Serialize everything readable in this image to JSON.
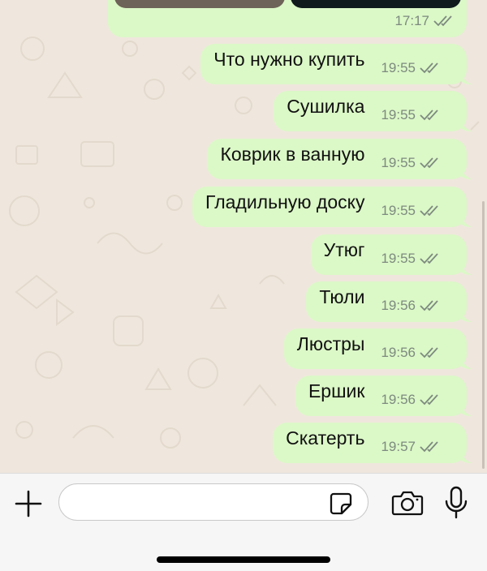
{
  "previous_message": {
    "time": "17:17",
    "status_icon": "double-check-icon"
  },
  "messages": [
    {
      "text": "Что нужно купить",
      "time": "19:55",
      "status_icon": "double-check-icon"
    },
    {
      "text": "Сушилка",
      "time": "19:55",
      "status_icon": "double-check-icon"
    },
    {
      "text": "Коврик в ванную",
      "time": "19:55",
      "status_icon": "double-check-icon"
    },
    {
      "text": "Гладильную доску",
      "time": "19:55",
      "status_icon": "double-check-icon"
    },
    {
      "text": "Утюг",
      "time": "19:55",
      "status_icon": "double-check-icon"
    },
    {
      "text": "Тюли",
      "time": "19:56",
      "status_icon": "double-check-icon"
    },
    {
      "text": "Люстры",
      "time": "19:56",
      "status_icon": "double-check-icon"
    },
    {
      "text": "Ершик",
      "time": "19:56",
      "status_icon": "double-check-icon"
    },
    {
      "text": "Скатерть",
      "time": "19:57",
      "status_icon": "double-check-icon"
    }
  ],
  "composer": {
    "input_value": "",
    "icons": [
      "plus-icon",
      "sticker-icon",
      "camera-icon",
      "microphone-icon"
    ]
  },
  "colors": {
    "outgoing_bubble": "#dbf8c7",
    "chat_background": "#efe7dd",
    "meta_text": "#7d8a7f"
  }
}
